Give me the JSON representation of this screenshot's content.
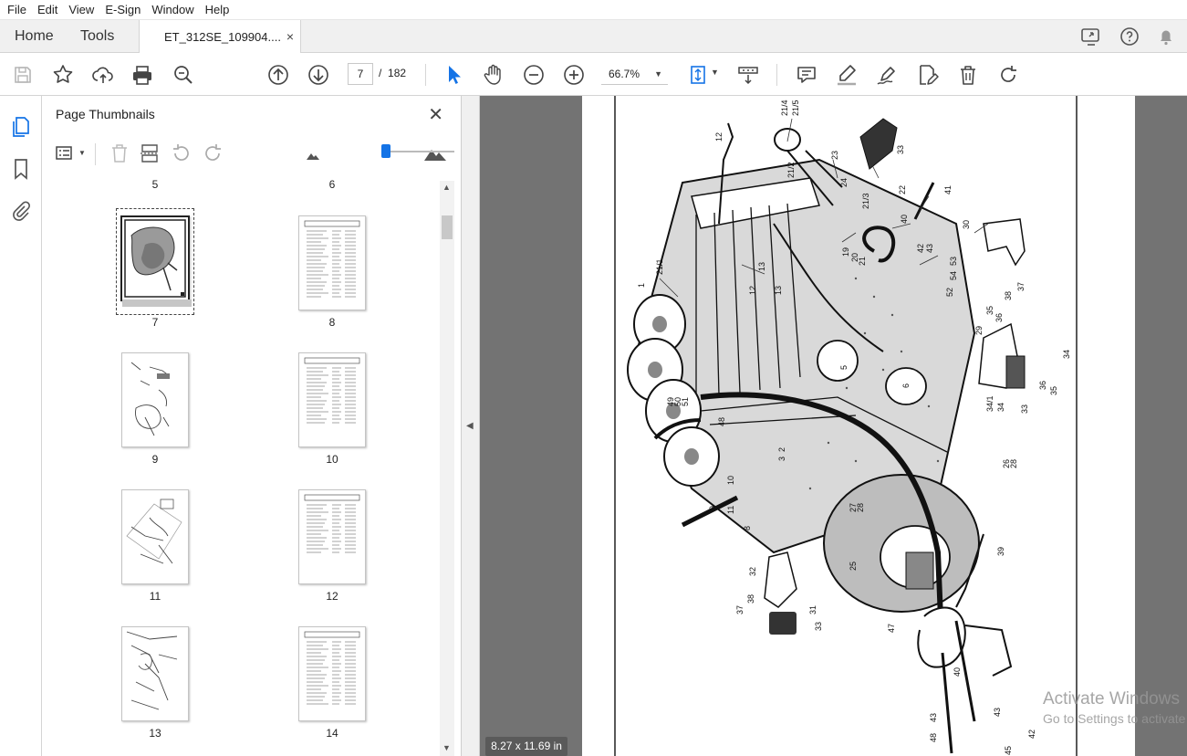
{
  "menu": [
    "File",
    "Edit",
    "View",
    "E-Sign",
    "Window",
    "Help"
  ],
  "tabs": {
    "home": "Home",
    "tools": "Tools",
    "document": "ET_312SE_109904....",
    "close_symbol": "×"
  },
  "toolbar": {
    "current_page": "7",
    "page_separator": "/",
    "total_pages": "182",
    "zoom": "66.7%"
  },
  "panel": {
    "title": "Page Thumbnails",
    "close_symbol": "✕"
  },
  "thumbnails": {
    "header_pages": [
      "5",
      "6"
    ],
    "pages": [
      "7",
      "8",
      "9",
      "10",
      "11",
      "12",
      "13",
      "14"
    ],
    "selected_page": "7"
  },
  "status": {
    "page_size": "8.27 x 11.69 in"
  },
  "watermark": {
    "line1": "Activate Windows",
    "line2": "Go to Settings to activate Windows."
  },
  "drawing_callouts": [
    "21/4",
    "21/5",
    "12",
    "23",
    "33",
    "21/2",
    "24",
    "22",
    "41",
    "21/3",
    "40",
    "30",
    "19",
    "20",
    "21",
    "42",
    "43",
    "53",
    "54",
    "13",
    "21/1",
    "52",
    "1",
    "12",
    "13",
    "37",
    "38",
    "35",
    "36",
    "29",
    "34",
    "5",
    "6",
    "49",
    "50",
    "51",
    "48",
    "34/1",
    "34",
    "33",
    "36",
    "35",
    "3",
    "2",
    "26",
    "28",
    "10",
    "9",
    "11",
    "8",
    "27",
    "28",
    "39",
    "25",
    "32",
    "37",
    "38",
    "31",
    "33",
    "47",
    "40",
    "43",
    "43",
    "42",
    "48",
    "45"
  ],
  "colors": {
    "accent": "#1473e6",
    "doc_background": "#737373",
    "tabbar": "#f0f0f0"
  }
}
